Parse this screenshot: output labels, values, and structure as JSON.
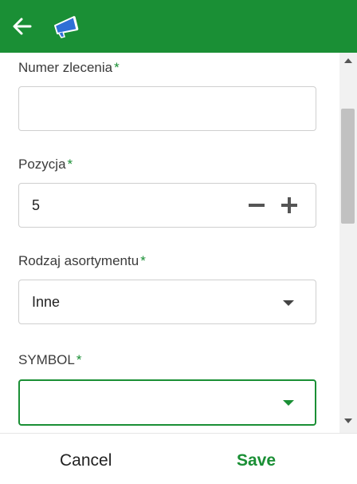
{
  "header": {
    "back_icon": "arrow-left-icon",
    "logo_icon": "megaphone-icon",
    "color": "#1a8f35"
  },
  "form": {
    "order_number": {
      "label": "Numer zlecenia",
      "required_mark": "*",
      "value": ""
    },
    "position": {
      "label": "Pozycja",
      "required_mark": "*",
      "value": "5",
      "minus_icon": "minus-icon",
      "plus_icon": "plus-icon"
    },
    "assortment_type": {
      "label": "Rodzaj asortymentu",
      "required_mark": "*",
      "value": "Inne",
      "dropdown_icon": "caret-down-icon"
    },
    "symbol": {
      "label": "SYMBOL",
      "required_mark": "*",
      "value": "",
      "dropdown_icon": "caret-down-icon"
    }
  },
  "footer": {
    "cancel_label": "Cancel",
    "save_label": "Save"
  }
}
